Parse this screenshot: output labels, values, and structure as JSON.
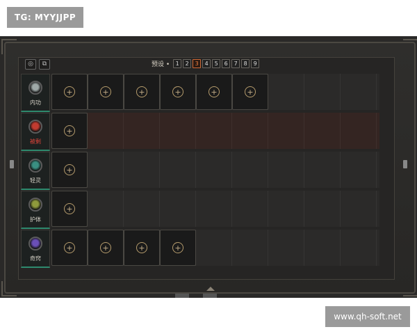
{
  "watermarks": {
    "top": "TG: MYYJJPP",
    "bottom": "www.qh-soft.net"
  },
  "toolbar": {
    "buttons": [
      {
        "icon": "gear-icon",
        "glyph": "◎"
      },
      {
        "icon": "copy-icon",
        "glyph": "⧉"
      }
    ]
  },
  "presets": {
    "label": "预设 •",
    "items": [
      "1",
      "2",
      "3",
      "4",
      "5",
      "6",
      "7",
      "8",
      "9"
    ],
    "active": "3"
  },
  "slot_glyph": "+",
  "categories": [
    {
      "label": "内功",
      "slots": 6,
      "tone": "normal",
      "icon_color": "#9fa9a8"
    },
    {
      "label": "被剩",
      "slots": 1,
      "tone": "red",
      "icon_color": "#c23b30"
    },
    {
      "label": "轻灵",
      "slots": 1,
      "tone": "normal",
      "icon_color": "#3a8f82"
    },
    {
      "label": "护体",
      "slots": 1,
      "tone": "normal",
      "icon_color": "#8f9a3c"
    },
    {
      "label": "奇窍",
      "slots": 4,
      "tone": "normal",
      "icon_color": "#6a4fb8"
    }
  ]
}
